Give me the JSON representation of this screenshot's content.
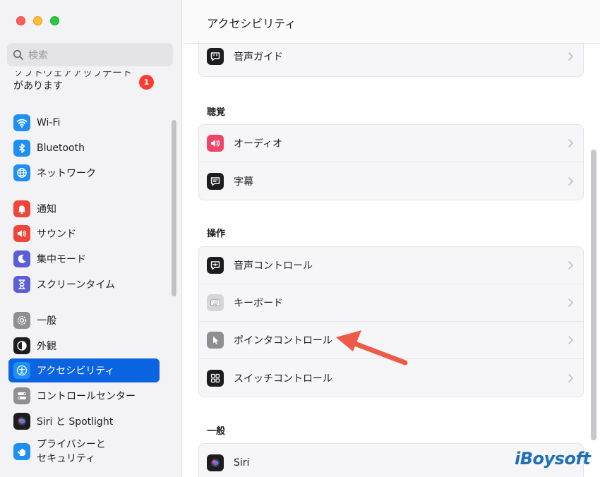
{
  "window": {
    "title": "アクセシビリティ"
  },
  "sidebar": {
    "search_placeholder": "検索",
    "update_notice": {
      "partial_line": "ソフトウェアアップデート",
      "line": "があります",
      "badge_count": "1"
    },
    "items": [
      {
        "label": "Wi-Fi",
        "icon": "wifi-icon",
        "color": "#1f8ff5"
      },
      {
        "label": "Bluetooth",
        "icon": "bluetooth-icon",
        "color": "#1f8ff5"
      },
      {
        "label": "ネットワーク",
        "icon": "globe-icon",
        "color": "#1f8ff5"
      },
      {
        "label": "通知",
        "icon": "bell-icon",
        "color": "#f0453a"
      },
      {
        "label": "サウンド",
        "icon": "speaker-icon",
        "color": "#f0453a"
      },
      {
        "label": "集中モード",
        "icon": "moon-icon",
        "color": "#5a5fd6"
      },
      {
        "label": "スクリーンタイム",
        "icon": "hourglass-icon",
        "color": "#5a5fd6"
      },
      {
        "label": "一般",
        "icon": "gear-icon",
        "color": "#8e8e93"
      },
      {
        "label": "外観",
        "icon": "appearance-icon",
        "color": "#1d1d1f"
      },
      {
        "label": "アクセシビリティ",
        "icon": "accessibility-icon",
        "color": "#1f8ff5",
        "selected": true
      },
      {
        "label": "コントロールセンター",
        "icon": "toggles-icon",
        "color": "#8e8e93"
      },
      {
        "label": "Siri と Spotlight",
        "icon": "siri-icon",
        "color": "#1d1d1f"
      },
      {
        "label_lines": [
          "プライバシーと",
          "セキュリティ"
        ],
        "icon": "hand-icon",
        "color": "#1f8ff5"
      }
    ]
  },
  "main": {
    "title": "アクセシビリティ",
    "groups": [
      {
        "heading": "",
        "rows": [
          {
            "label": "音声ガイド",
            "icon": "voiceover-icon",
            "color": "#1d1d1f"
          }
        ]
      },
      {
        "heading": "聴覚",
        "rows": [
          {
            "label": "オーディオ",
            "icon": "audio-icon",
            "color": "#f0456a"
          },
          {
            "label": "字幕",
            "icon": "captions-icon",
            "color": "#1d1d1f"
          }
        ]
      },
      {
        "heading": "操作",
        "rows": [
          {
            "label": "音声コントロール",
            "icon": "voice-control-icon",
            "color": "#1d1d1f"
          },
          {
            "label": "キーボード",
            "icon": "keyboard-icon",
            "color": "#b0b0b5"
          },
          {
            "label": "ポインタコントロール",
            "icon": "pointer-icon",
            "color": "#8e8e93"
          },
          {
            "label": "スイッチコントロール",
            "icon": "switch-control-icon",
            "color": "#1d1d1f"
          }
        ]
      },
      {
        "heading": "一般",
        "rows": [
          {
            "label": "Siri",
            "icon": "siri-icon",
            "color": "#1d1d1f"
          }
        ]
      }
    ]
  },
  "annotation": {
    "arrow_color": "#ee5a48"
  },
  "watermark": "iBoysoft"
}
